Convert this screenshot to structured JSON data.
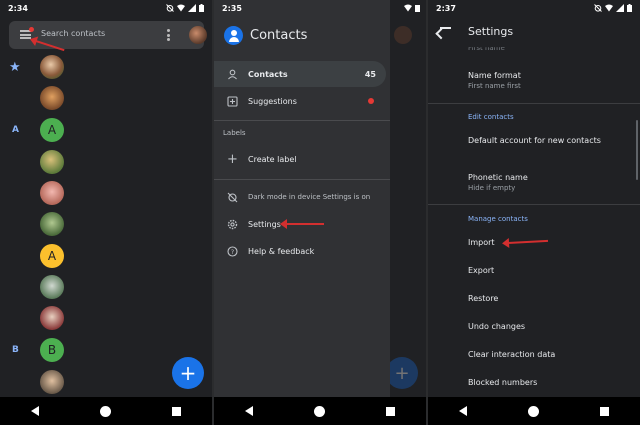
{
  "colors": {
    "accent": "#8ab4f8",
    "fab": "#1a73e8",
    "annotation_arrow": "#d32f2f",
    "badge": "#e53935",
    "background": "#202124",
    "drawer": "#303134"
  },
  "panel1": {
    "time": "2:34",
    "search_placeholder": "Search contacts",
    "section_letters": [
      "A",
      "B"
    ],
    "letter_avatars": [
      "A",
      "A",
      "B"
    ],
    "fab_label": "+"
  },
  "panel2": {
    "time": "2:35",
    "app_title": "Contacts",
    "items": {
      "contacts": {
        "label": "Contacts",
        "count": "45"
      },
      "suggestions": {
        "label": "Suggestions"
      },
      "labels_heading": "Labels",
      "create_label": "Create label",
      "dark_mode": "Dark mode in device Settings is on",
      "settings": "Settings",
      "help": "Help & feedback"
    },
    "fab_label": "+"
  },
  "panel3": {
    "time": "2:37",
    "title": "Settings",
    "clipped_row": "First name",
    "name_format": {
      "label": "Name format",
      "value": "First name first"
    },
    "edit_contacts_section": "Edit contacts",
    "default_account": "Default account for new contacts",
    "phonetic_name": {
      "label": "Phonetic name",
      "value": "Hide if empty"
    },
    "manage_contacts_section": "Manage contacts",
    "import": "Import",
    "export": "Export",
    "restore": "Restore",
    "undo_changes": "Undo changes",
    "clear_interaction_data": "Clear interaction data",
    "blocked_numbers": "Blocked numbers"
  },
  "icons": {
    "status": [
      "alarm-off-icon",
      "wifi-icon",
      "signal-icon",
      "battery-icon"
    ],
    "nav": [
      "back-icon",
      "home-icon",
      "recents-icon"
    ]
  }
}
